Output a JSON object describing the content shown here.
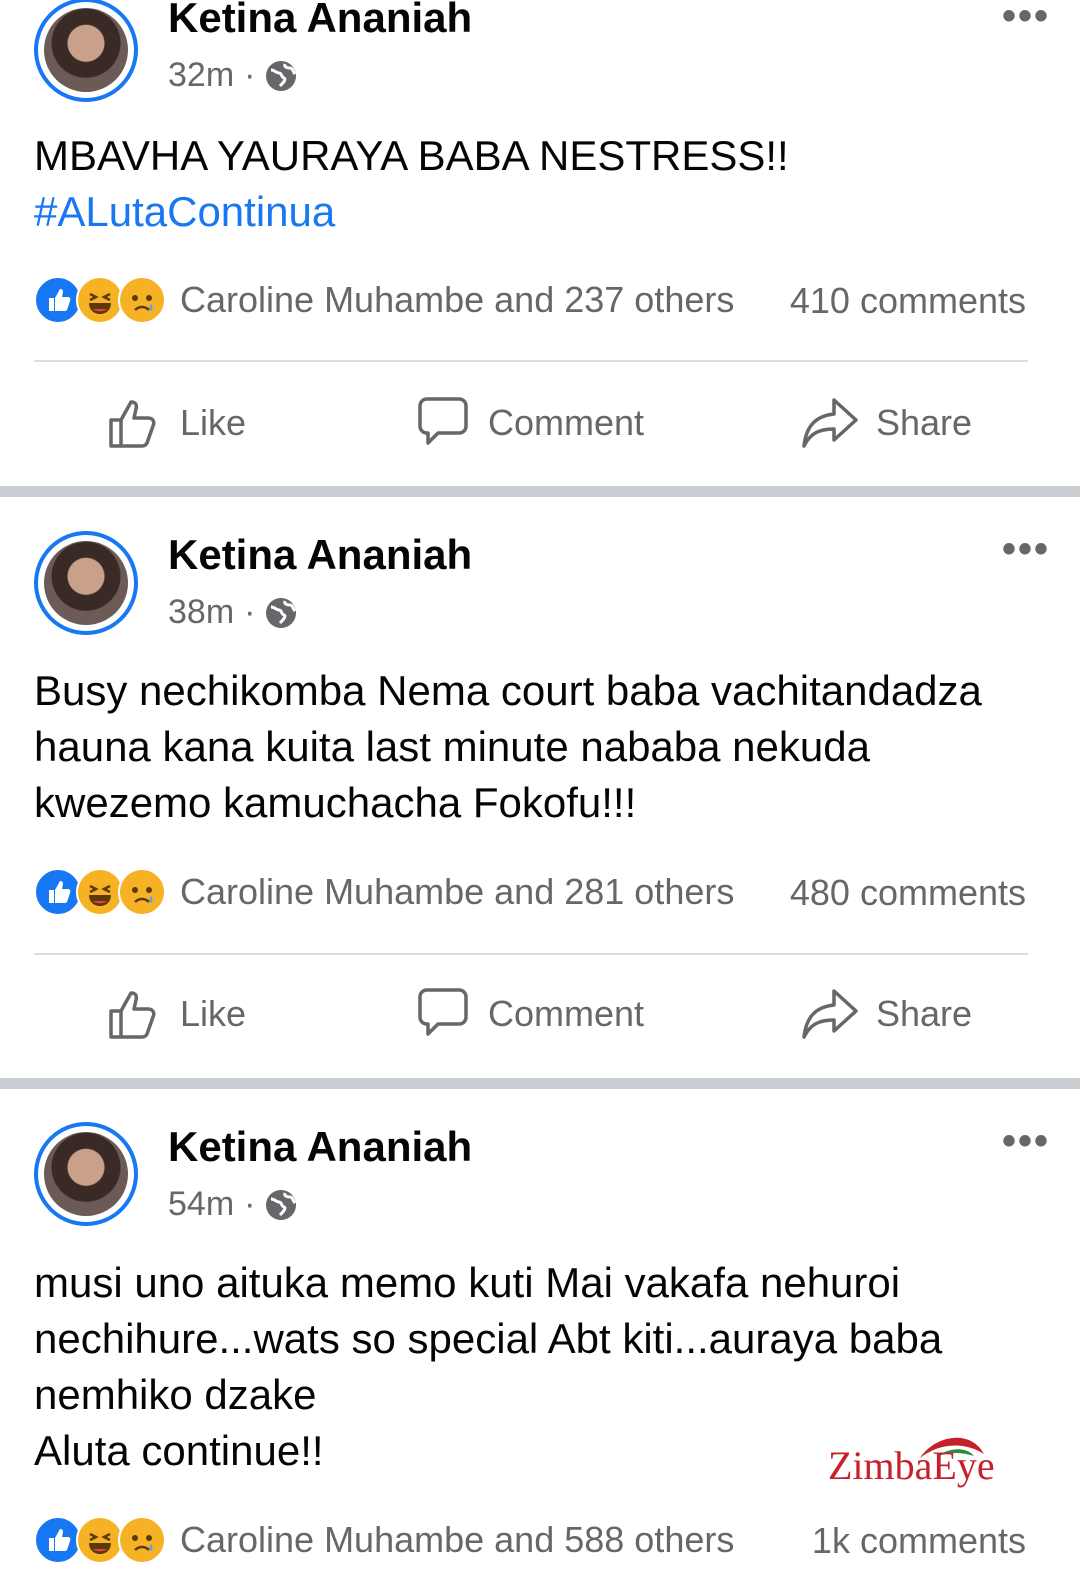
{
  "posts": [
    {
      "author": "Ketina Ananiah",
      "time": "32m",
      "text_lines": [
        "MBAVHA YAURAYA BABA NESTRESS!!"
      ],
      "hashtag": "#ALutaContinua",
      "reactions_text": "Caroline Muhambe and 237 others",
      "comments": "410 comments"
    },
    {
      "author": "Ketina Ananiah",
      "time": "38m",
      "text_lines": [
        "Busy nechikomba Nema court baba vachitandadza",
        "hauna kana kuita last minute nababa nekuda",
        "kwezemo kamuchacha Fokofu!!!"
      ],
      "reactions_text": "Caroline Muhambe and 281 others",
      "comments": "480 comments"
    },
    {
      "author": "Ketina Ananiah",
      "time": "54m",
      "text_lines": [
        "musi uno aituka memo kuti Mai vakafa nehuroi",
        "nechihure...wats so special Abt kiti...auraya baba",
        "nemhiko dzake",
        "Aluta continue!!"
      ],
      "reactions_text": "Caroline Muhambe and 588 others",
      "comments": "1k comments"
    }
  ],
  "actions": {
    "like": "Like",
    "comment": "Comment",
    "share": "Share"
  },
  "separator": "·",
  "more": "•••",
  "watermark": "ZimbaEye",
  "colors": {
    "accent": "#1877f2",
    "secondary_text": "#65676b",
    "separator": "#c9ccd1"
  },
  "icons": [
    "globe-icon",
    "more-options-icon",
    "like-icon",
    "comment-icon",
    "share-icon",
    "like-reaction-icon",
    "haha-reaction-icon",
    "sad-reaction-icon"
  ]
}
